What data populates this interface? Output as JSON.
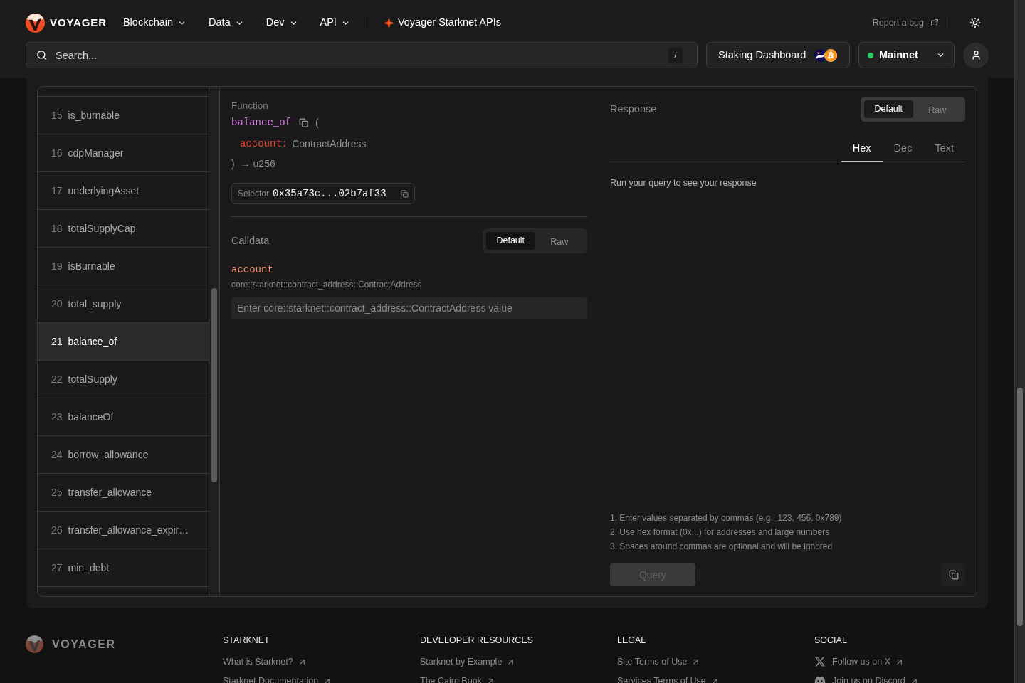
{
  "header": {
    "logo": {
      "wordmark": "VOYAGER"
    },
    "nav": [
      {
        "label": "Blockchain"
      },
      {
        "label": "Data"
      },
      {
        "label": "Dev"
      },
      {
        "label": "API"
      }
    ],
    "highlight_link": {
      "label": "Voyager Starknet APIs"
    },
    "report_bug": {
      "label": "Report a bug"
    },
    "search": {
      "placeholder": "Search...",
      "shortcut": "/"
    },
    "staking_button": {
      "label": "Staking Dashboard"
    },
    "network": {
      "label": "Mainnet",
      "connected": true
    }
  },
  "functions": [
    {
      "number": "15",
      "name": "is_burnable",
      "selected": false
    },
    {
      "number": "16",
      "name": "cdpManager",
      "selected": false
    },
    {
      "number": "17",
      "name": "underlyingAsset",
      "selected": false
    },
    {
      "number": "18",
      "name": "totalSupplyCap",
      "selected": false
    },
    {
      "number": "19",
      "name": "isBurnable",
      "selected": false
    },
    {
      "number": "20",
      "name": "total_supply",
      "selected": false
    },
    {
      "number": "21",
      "name": "balance_of",
      "selected": true
    },
    {
      "number": "22",
      "name": "totalSupply",
      "selected": false
    },
    {
      "number": "23",
      "name": "balanceOf",
      "selected": false
    },
    {
      "number": "24",
      "name": "borrow_allowance",
      "selected": false
    },
    {
      "number": "25",
      "name": "transfer_allowance",
      "selected": false
    },
    {
      "number": "26",
      "name": "transfer_allowance_expir…",
      "selected": false
    },
    {
      "number": "27",
      "name": "min_debt",
      "selected": false
    }
  ],
  "function_panel": {
    "label": "Function",
    "name": "balance_of",
    "open": "(",
    "params": [
      {
        "name": "account:",
        "type": "ContractAddress"
      }
    ],
    "close": ")",
    "returns": "→ u256",
    "selector": {
      "label": "Selector",
      "value": "0x35a73c...02b7af33"
    }
  },
  "calldata": {
    "label": "Calldata",
    "modes": [
      {
        "label": "Default",
        "selected": true
      },
      {
        "label": "Raw",
        "selected": false
      }
    ],
    "inputs": [
      {
        "name": "account",
        "type": "core::starknet::contract_address::ContractAddress",
        "placeholder": "Enter core::starknet::contract_address::ContractAddress value"
      }
    ]
  },
  "response": {
    "label": "Response",
    "modes": [
      {
        "label": "Default",
        "selected": true
      },
      {
        "label": "Raw",
        "selected": false
      }
    ],
    "tabs": [
      {
        "label": "Hex",
        "selected": true
      },
      {
        "label": "Dec",
        "selected": false
      },
      {
        "label": "Text",
        "selected": false
      }
    ],
    "empty_message": "Run your query to see your response",
    "notes": [
      "1. Enter values separated by commas (e.g., 123, 456, 0x789)",
      "2. Use hex format (0x...) for addresses and large numbers",
      "3. Spaces around commas are optional and will be ignored"
    ],
    "query_button": {
      "label": "Query",
      "disabled": true
    }
  },
  "footer": {
    "wordmark": "VOYAGER",
    "columns": [
      {
        "kind": "links",
        "heading": "STARKNET",
        "links": [
          "What is Starknet?",
          "Starknet Documentation"
        ]
      },
      {
        "kind": "links",
        "heading": "DEVELOPER RESOURCES",
        "links": [
          "Starknet by Example",
          "The Cairo Book"
        ]
      },
      {
        "kind": "links",
        "heading": "LEGAL",
        "links": [
          "Site Terms of Use",
          "Services Terms of Use"
        ]
      },
      {
        "kind": "social",
        "heading": "SOCIAL",
        "links": [
          "Follow us on X",
          "Join us on Discord"
        ]
      }
    ]
  }
}
